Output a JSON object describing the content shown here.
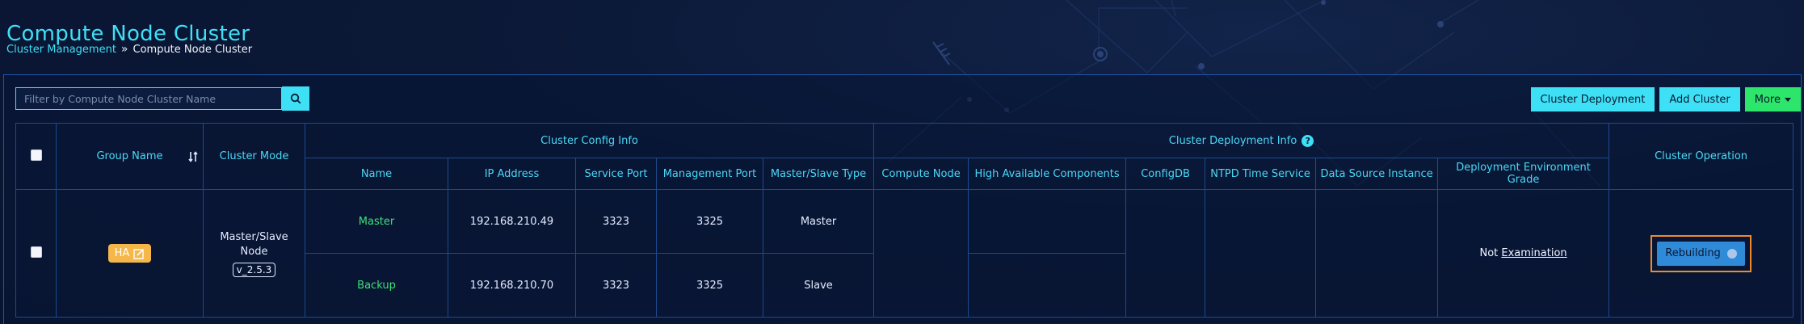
{
  "page": {
    "title": "Compute Node Cluster",
    "breadcrumb": {
      "parent": "Cluster Management",
      "separator": "»",
      "current": "Compute Node Cluster"
    }
  },
  "toolbar": {
    "search_placeholder": "Filter by Compute Node Cluster Name",
    "buttons": {
      "cluster_deployment": "Cluster Deployment",
      "add_cluster": "Add Cluster",
      "more": "More"
    }
  },
  "table": {
    "headers": {
      "group_name": "Group Name",
      "cluster_mode": "Cluster Mode",
      "cluster_config_info": "Cluster Config Info",
      "cluster_deployment_info": "Cluster Deployment Info",
      "cluster_operation": "Cluster Operation",
      "name": "Name",
      "ip_address": "IP Address",
      "service_port": "Service Port",
      "management_port": "Management Port",
      "master_slave_type": "Master/Slave Type",
      "compute_node": "Compute Node",
      "ha_components": "High Available Components",
      "configdb": "ConfigDB",
      "ntpd": "NTPD Time Service",
      "data_source_instance": "Data Source Instance",
      "deployment_env_grade": "Deployment Environment Grade"
    },
    "row": {
      "group_badge": "HA",
      "cluster_mode": "Master/Slave Node",
      "version": "v_2.5.3",
      "nodes": [
        {
          "name": "Master",
          "ip": "192.168.210.49",
          "service_port": "3323",
          "management_port": "3325",
          "type": "Master"
        },
        {
          "name": "Backup",
          "ip": "192.168.210.70",
          "service_port": "3323",
          "management_port": "3325",
          "type": "Slave"
        }
      ],
      "env_grade_prefix": "Not",
      "env_grade_link": "Examination",
      "operation": "Rebuilding"
    }
  },
  "colors": {
    "accent": "#3ee0f5",
    "green": "#2ee56b",
    "badge": "#f5b74a",
    "highlight": "#f08a2e"
  }
}
